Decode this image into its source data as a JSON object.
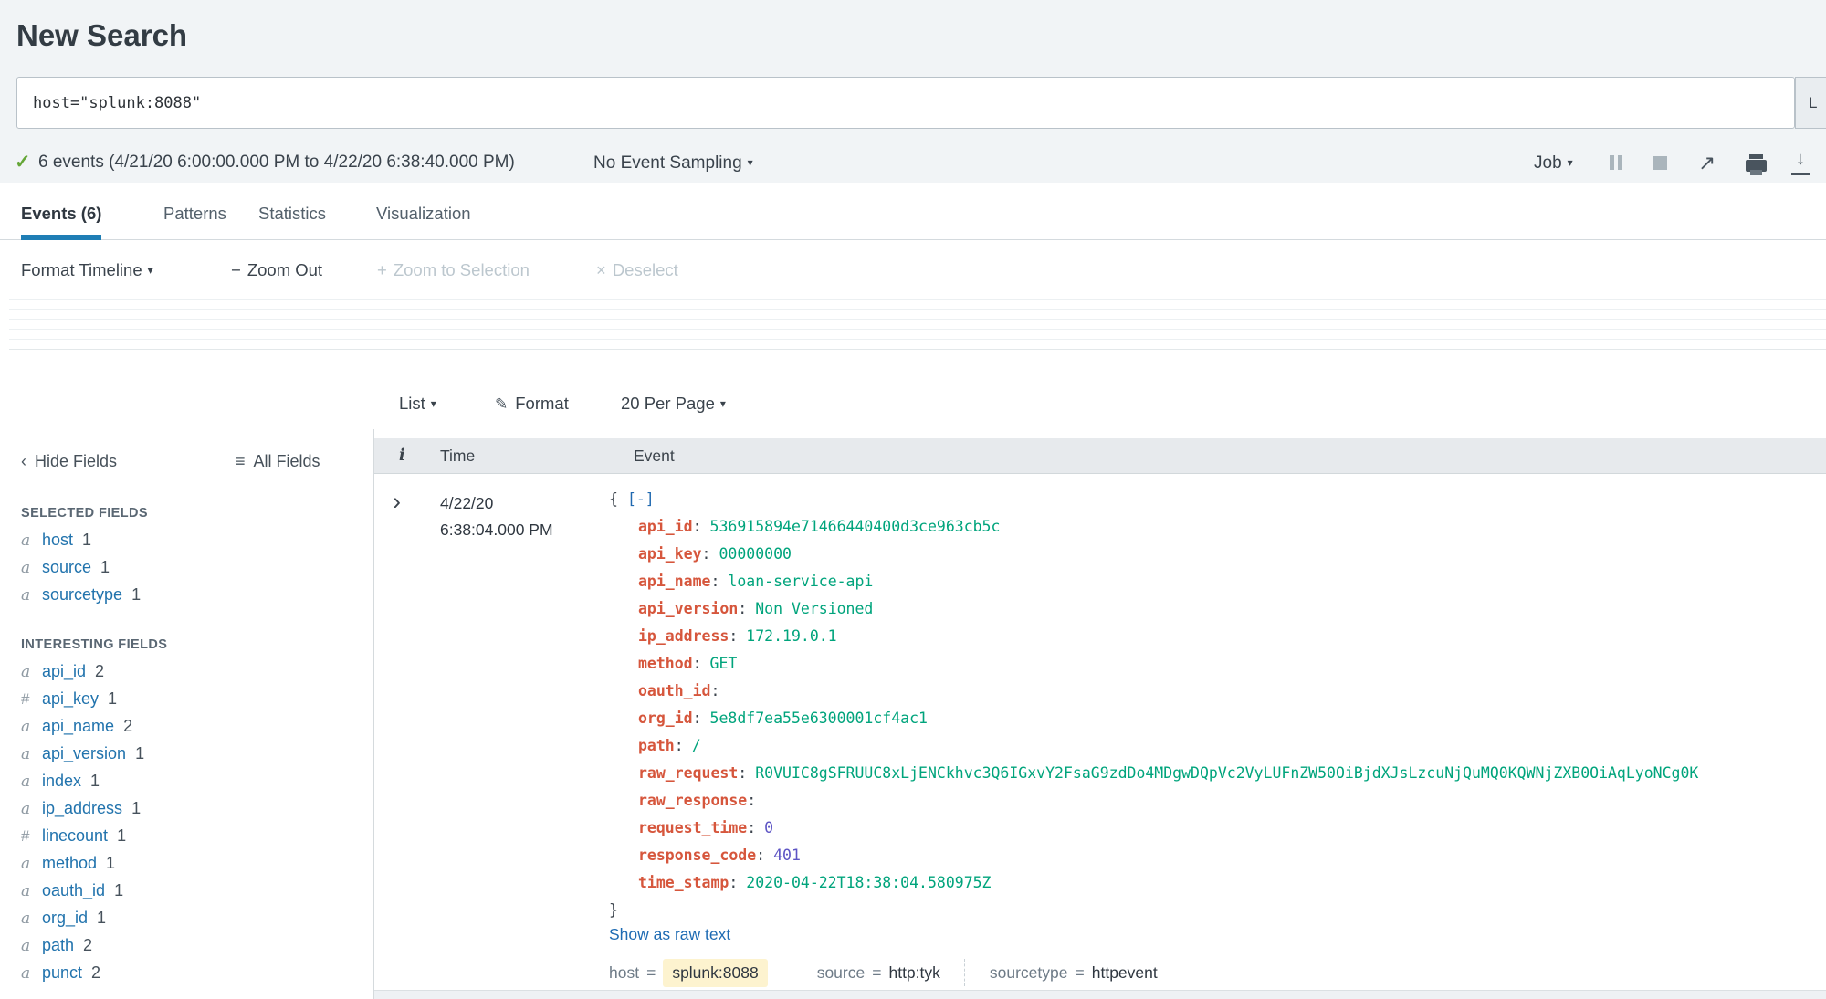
{
  "header": {
    "title": "New Search",
    "search_query": "host=\"splunk:8088\"",
    "time_picker_partial": "L",
    "result_summary": "6 events (4/21/20 6:00:00.000 PM to 4/22/20 6:38:40.000 PM)",
    "sampling_label": "No Event Sampling",
    "job_label": "Job"
  },
  "icons": {
    "check": "✓",
    "caret_down": "▾",
    "chevron_left": "‹",
    "chevron_right": "›",
    "list": "≡",
    "pencil": "✎",
    "minus": "−",
    "plus": "+",
    "close": "×",
    "share_arrow": "↗",
    "download_arrow": "↓"
  },
  "tabs": [
    {
      "label": "Events (6)"
    },
    {
      "label": "Patterns"
    },
    {
      "label": "Statistics"
    },
    {
      "label": "Visualization"
    }
  ],
  "timeline_bar": {
    "format_timeline": "Format Timeline",
    "zoom_out": "Zoom Out",
    "zoom_to_selection": "Zoom to Selection",
    "deselect": "Deselect"
  },
  "view_bar": {
    "list": "List",
    "format": "Format",
    "per_page": "20 Per Page"
  },
  "results_table": {
    "info_col": "i",
    "time_col": "Time",
    "event_col": "Event"
  },
  "fields_panel": {
    "hide_fields": "Hide Fields",
    "all_fields": "All Fields",
    "selected_heading": "SELECTED FIELDS",
    "interesting_heading": "INTERESTING FIELDS",
    "selected": [
      {
        "prefix": "a",
        "name": "host",
        "count": "1"
      },
      {
        "prefix": "a",
        "name": "source",
        "count": "1"
      },
      {
        "prefix": "a",
        "name": "sourcetype",
        "count": "1"
      }
    ],
    "interesting": [
      {
        "prefix": "a",
        "name": "api_id",
        "count": "2"
      },
      {
        "prefix": "#",
        "name": "api_key",
        "count": "1"
      },
      {
        "prefix": "a",
        "name": "api_name",
        "count": "2"
      },
      {
        "prefix": "a",
        "name": "api_version",
        "count": "1"
      },
      {
        "prefix": "a",
        "name": "index",
        "count": "1"
      },
      {
        "prefix": "a",
        "name": "ip_address",
        "count": "1"
      },
      {
        "prefix": "#",
        "name": "linecount",
        "count": "1"
      },
      {
        "prefix": "a",
        "name": "method",
        "count": "1"
      },
      {
        "prefix": "a",
        "name": "oauth_id",
        "count": "1"
      },
      {
        "prefix": "a",
        "name": "org_id",
        "count": "1"
      },
      {
        "prefix": "a",
        "name": "path",
        "count": "2"
      },
      {
        "prefix": "a",
        "name": "punct",
        "count": "2"
      }
    ]
  },
  "event": {
    "date": "4/22/20",
    "time": "6:38:04.000 PM",
    "syntax": {
      "open": "{",
      "close": "}",
      "collapse": "[-]",
      "colon": ":",
      "equals": "="
    },
    "json_fields": [
      {
        "key": "api_id",
        "value": "536915894e71466440400d3ce963cb5c",
        "type": "string"
      },
      {
        "key": "api_key",
        "value": "00000000",
        "type": "string"
      },
      {
        "key": "api_name",
        "value": "loan-service-api",
        "type": "string"
      },
      {
        "key": "api_version",
        "value": "Non Versioned",
        "type": "string"
      },
      {
        "key": "ip_address",
        "value": "172.19.0.1",
        "type": "string"
      },
      {
        "key": "method",
        "value": "GET",
        "type": "string"
      },
      {
        "key": "oauth_id",
        "value": "",
        "type": "string"
      },
      {
        "key": "org_id",
        "value": "5e8df7ea55e6300001cf4ac1",
        "type": "string"
      },
      {
        "key": "path",
        "value": "/",
        "type": "string"
      },
      {
        "key": "raw_request",
        "value": "R0VUIC8gSFRUUC8xLjENCkhvc3Q6IGxvY2FsaG9zdDo4MDgwDQpVc2VyLUFnZW50OiBjdXJsLzcuNjQuMQ0KQWNjZXB0OiAqLyoNCg0K",
        "type": "string"
      },
      {
        "key": "raw_response",
        "value": "",
        "type": "string"
      },
      {
        "key": "request_time",
        "value": "0",
        "type": "number"
      },
      {
        "key": "response_code",
        "value": "401",
        "type": "number"
      },
      {
        "key": "time_stamp",
        "value": "2020-04-22T18:38:04.580975Z",
        "type": "string"
      }
    ],
    "show_raw": "Show as raw text",
    "meta": [
      {
        "label": "host",
        "value": "splunk:8088"
      },
      {
        "label": "source",
        "value": "http:tyk"
      },
      {
        "label": "sourcetype",
        "value": "httpevent"
      }
    ]
  },
  "colors": {
    "tab_accent": "#1f7eb5",
    "link_blue": "#1e6bb3",
    "field_blue": "#2173ad",
    "json_key_red": "#d6563c",
    "json_string_teal": "#00a47c",
    "json_number_purple": "#5d54c4",
    "check_green": "#65a637",
    "highlight_bg": "#fdf3cf",
    "header_bg": "#f1f4f6",
    "table_header_bg": "#e7eaed"
  }
}
